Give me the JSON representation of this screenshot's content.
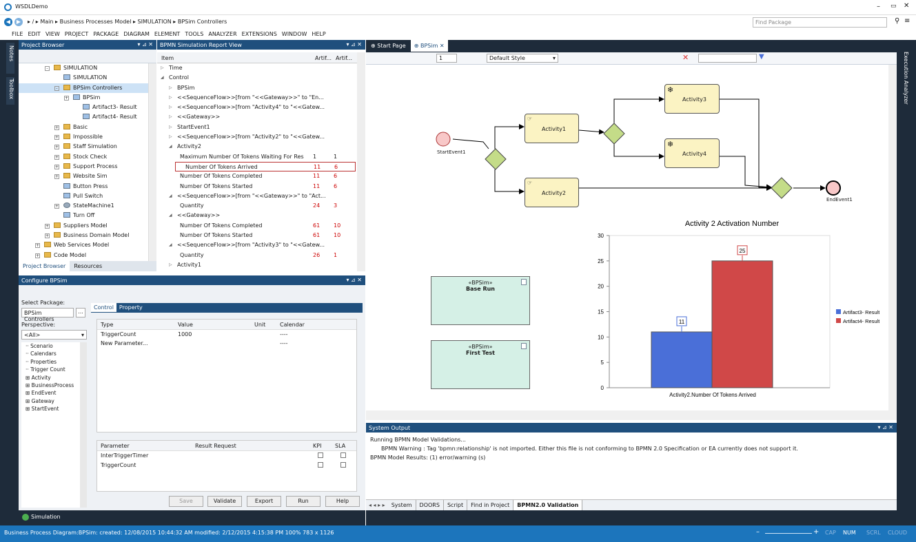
{
  "app": {
    "title": "WSDLDemo"
  },
  "breadcrumb": [
    "/",
    "Main",
    "Business Processes Model",
    "SIMULATION",
    "BPSim Controllers"
  ],
  "find_package": {
    "placeholder": "Find Package"
  },
  "menu": [
    "FILE",
    "EDIT",
    "VIEW",
    "PROJECT",
    "PACKAGE",
    "DIAGRAM",
    "ELEMENT",
    "TOOLS",
    "ANALYZER",
    "EXTENSIONS",
    "WINDOW",
    "HELP"
  ],
  "left_strip": [
    "Notes",
    "Toolbox"
  ],
  "right_strip": "Execution Analyzer",
  "project_browser": {
    "title": "Project Browser",
    "items": [
      {
        "label": "SIMULATION",
        "indent": 2,
        "type": "folder",
        "exp": "-"
      },
      {
        "label": "SIMULATION",
        "indent": 3,
        "type": "diagram",
        "exp": ""
      },
      {
        "label": "BPSim Controllers",
        "indent": 3,
        "type": "folder",
        "exp": "-",
        "selected": true
      },
      {
        "label": "BPSim",
        "indent": 4,
        "type": "class",
        "exp": "+"
      },
      {
        "label": "Artifact3- Result",
        "indent": 5,
        "type": "artifact",
        "exp": ""
      },
      {
        "label": "Artifact4- Result",
        "indent": 5,
        "type": "artifact",
        "exp": ""
      },
      {
        "label": "Basic",
        "indent": 3,
        "type": "folder",
        "exp": "+"
      },
      {
        "label": "Impossible",
        "indent": 3,
        "type": "folder",
        "exp": "+"
      },
      {
        "label": "Staff Simulation",
        "indent": 3,
        "type": "folder",
        "exp": "+"
      },
      {
        "label": "Stock Check",
        "indent": 3,
        "type": "folder",
        "exp": "+"
      },
      {
        "label": "Support Process",
        "indent": 3,
        "type": "folder",
        "exp": "+"
      },
      {
        "label": "Website Sim",
        "indent": 3,
        "type": "folder",
        "exp": "+"
      },
      {
        "label": "Button Press",
        "indent": 3,
        "type": "element",
        "exp": ""
      },
      {
        "label": "Pull Switch",
        "indent": 3,
        "type": "element",
        "exp": ""
      },
      {
        "label": "StateMachine1",
        "indent": 3,
        "type": "state",
        "exp": "+"
      },
      {
        "label": "Turn Off",
        "indent": 3,
        "type": "element",
        "exp": ""
      },
      {
        "label": "Suppliers Model",
        "indent": 2,
        "type": "folder",
        "exp": "+"
      },
      {
        "label": "Business Domain Model",
        "indent": 2,
        "type": "folder",
        "exp": "+"
      },
      {
        "label": "Web Services Model",
        "indent": 1,
        "type": "folder",
        "exp": "+"
      },
      {
        "label": "Code Model",
        "indent": 1,
        "type": "folder",
        "exp": "+"
      }
    ],
    "tabs": [
      "Project Browser",
      "Resources"
    ]
  },
  "report": {
    "title": "BPMN Simulation Report View",
    "columns": [
      "Item",
      "Artif...",
      "Artif..."
    ],
    "rows": [
      {
        "label": "Time",
        "indent": 0,
        "arrow": "▷",
        "v1": "",
        "v2": ""
      },
      {
        "label": "Control",
        "indent": 0,
        "arrow": "◢",
        "v1": "",
        "v2": ""
      },
      {
        "label": "BPSim",
        "indent": 1,
        "arrow": "▷",
        "v1": "",
        "v2": ""
      },
      {
        "label": "<<SequenceFlow>>[from \"<<Gateway>>\" to \"En...",
        "indent": 1,
        "arrow": "▷",
        "v1": "",
        "v2": ""
      },
      {
        "label": "<<SequenceFlow>>[from \"Activity4\" to \"<<Gatew...",
        "indent": 1,
        "arrow": "▷",
        "v1": "",
        "v2": ""
      },
      {
        "label": "<<Gateway>>",
        "indent": 1,
        "arrow": "▷",
        "v1": "",
        "v2": ""
      },
      {
        "label": "StartEvent1",
        "indent": 1,
        "arrow": "▷",
        "v1": "",
        "v2": ""
      },
      {
        "label": "<<SequenceFlow>>[from \"Activity2\" to \"<<Gatew...",
        "indent": 1,
        "arrow": "▷",
        "v1": "",
        "v2": ""
      },
      {
        "label": "Activity2",
        "indent": 1,
        "arrow": "◢",
        "v1": "",
        "v2": ""
      },
      {
        "label": "Maximum Number Of Tokens Waiting For Reso...",
        "indent": 2,
        "arrow": "",
        "v1": "1",
        "v2": "1",
        "red": false
      },
      {
        "label": "Number Of Tokens Arrived",
        "indent": 2,
        "arrow": "",
        "v1": "11",
        "v2": "6",
        "red": true,
        "selected": true
      },
      {
        "label": "Number Of Tokens Completed",
        "indent": 2,
        "arrow": "",
        "v1": "11",
        "v2": "6",
        "red": true
      },
      {
        "label": "Number Of Tokens Started",
        "indent": 2,
        "arrow": "",
        "v1": "11",
        "v2": "6",
        "red": true
      },
      {
        "label": "<<SequenceFlow>>[from \"<<Gateway>>\" to \"Act...",
        "indent": 1,
        "arrow": "◢",
        "v1": "",
        "v2": ""
      },
      {
        "label": "Quantity",
        "indent": 2,
        "arrow": "",
        "v1": "24",
        "v2": "3",
        "red": true
      },
      {
        "label": "<<Gateway>>",
        "indent": 1,
        "arrow": "◢",
        "v1": "",
        "v2": ""
      },
      {
        "label": "Number Of Tokens Completed",
        "indent": 2,
        "arrow": "",
        "v1": "61",
        "v2": "10",
        "red": true
      },
      {
        "label": "Number Of Tokens Started",
        "indent": 2,
        "arrow": "",
        "v1": "61",
        "v2": "10",
        "red": true
      },
      {
        "label": "<<SequenceFlow>>[from \"Activity3\" to \"<<Gatew...",
        "indent": 1,
        "arrow": "◢",
        "v1": "",
        "v2": ""
      },
      {
        "label": "Quantity",
        "indent": 2,
        "arrow": "",
        "v1": "26",
        "v2": "1",
        "red": true
      },
      {
        "label": "Activity1",
        "indent": 1,
        "arrow": "▷",
        "v1": "",
        "v2": ""
      }
    ]
  },
  "configure": {
    "title": "Configure BPSim",
    "select_package_label": "Select Package:",
    "package": "BPSim Controllers",
    "perspective_label": "Perspective:",
    "perspective": "<All>",
    "tree": [
      "Scenario",
      "Calendars",
      "Properties",
      "Trigger Count",
      "Activity",
      "BusinessProcess",
      "EndEvent",
      "Gateway",
      "StartEvent"
    ],
    "tabs": [
      "Control",
      "Property"
    ],
    "grid_cols": [
      "Type",
      "Value",
      "Unit",
      "Calendar"
    ],
    "grid_rows": [
      {
        "type": "TriggerCount",
        "value": "1000",
        "unit": "",
        "cal": "----"
      },
      {
        "type": "New Parameter...",
        "value": "",
        "unit": "",
        "cal": "----"
      }
    ],
    "param_cols": [
      "Parameter",
      "Result Request",
      "KPI",
      "SLA"
    ],
    "params": [
      "InterTriggerTimer",
      "TriggerCount"
    ],
    "buttons": [
      "Save",
      "Validate",
      "Export",
      "Run",
      "Help"
    ],
    "footer_tab": "Simulation"
  },
  "diagram": {
    "tabs": [
      "Start Page",
      "BPSim"
    ],
    "page_num": "1",
    "style": "Default Style",
    "nodes": {
      "start": "StartEvent1",
      "a1": "Activity1",
      "a2": "Activity2",
      "a3": "Activity3",
      "a4": "Activity4",
      "end": "EndEvent1"
    },
    "notes": [
      {
        "stereo": "«BPSim»",
        "name": "Base Run"
      },
      {
        "stereo": "«BPSim»",
        "name": "First Test"
      }
    ]
  },
  "chart_data": {
    "type": "bar",
    "title": "Activity 2 Activation Number",
    "categories": [
      "Activity2.Number Of Tokens Arrived"
    ],
    "series": [
      {
        "name": "Artifact3- Result",
        "values": [
          11
        ],
        "color": "#4a6fd8"
      },
      {
        "name": "Artifact4- Result",
        "values": [
          25
        ],
        "color": "#d04848"
      }
    ],
    "ylim": [
      0,
      30
    ],
    "yticks": [
      0,
      5,
      10,
      15,
      20,
      25,
      30
    ],
    "legend": "right"
  },
  "system_output": {
    "title": "System Output",
    "lines": [
      "Running BPMN Model Validations...",
      "BPMN Warning : Tag 'bpmn:relationship' is not imported. Either this file is not conforming to BPMN 2.0 Specification or EA currently does not support it.",
      "BPMN Model Results: (1) error/warning (s)"
    ],
    "tabs": [
      "System",
      "DOORS",
      "Script",
      "Find in Project",
      "BPMN2.0 Validation"
    ]
  },
  "status": {
    "text": "Business Process Diagram:BPSim:  created: 12/08/2015 10:44:32 AM  modified: 2/12/2015 4:15:38 PM  100%  783 x 1126",
    "indicators": [
      "CAP",
      "NUM",
      "SCRL",
      "CLOUD"
    ]
  }
}
